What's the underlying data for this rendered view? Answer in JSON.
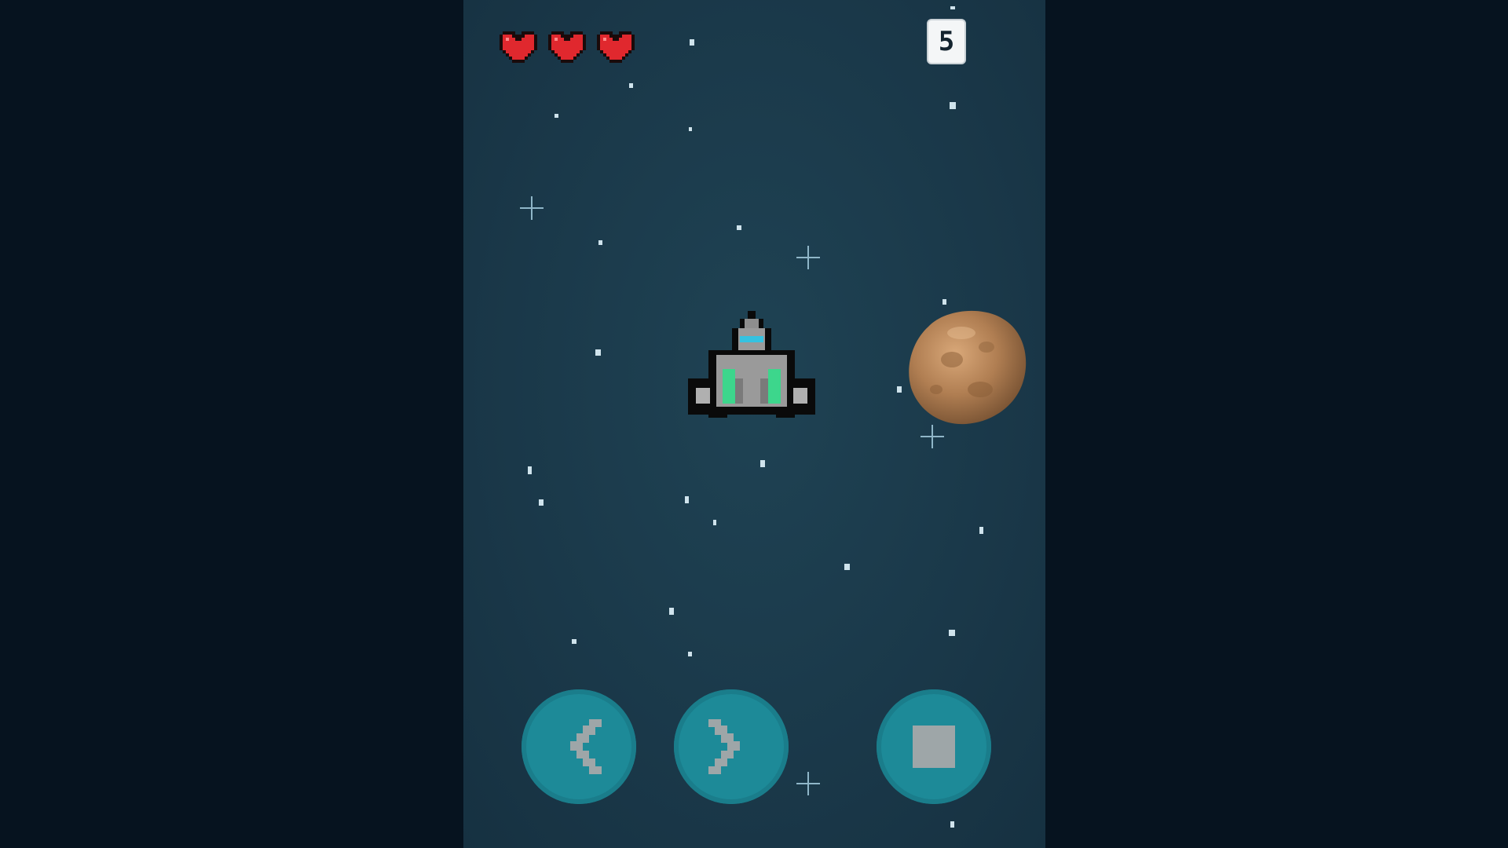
{
  "hud": {
    "lives": 3,
    "score": "5"
  },
  "controls": {
    "left_icon": "chevron-left-icon",
    "right_icon": "chevron-right-icon",
    "fire_icon": "square-icon"
  },
  "colors": {
    "background": "#1b3a4b",
    "heart": "#e0282e",
    "button": "#1d8a98",
    "button_icon": "#9ea6a8",
    "ship_body": "#9a9a9a",
    "ship_engine": "#3dd68c",
    "asteroid": "#b07e52"
  }
}
